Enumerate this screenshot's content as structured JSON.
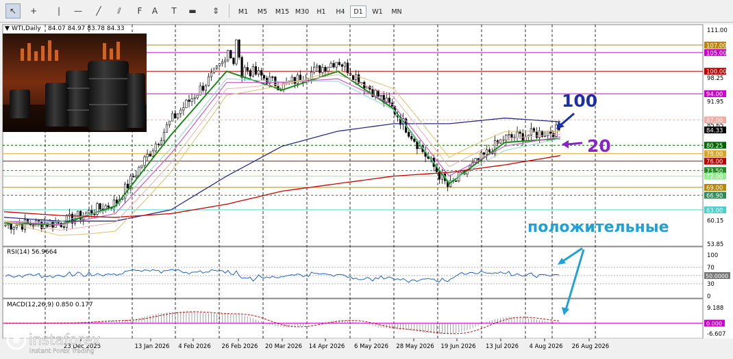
{
  "toolbar": {
    "tools": [
      {
        "name": "cursor",
        "glyph": "↖"
      },
      {
        "name": "crosshair",
        "glyph": "+"
      },
      {
        "name": "vertical-line",
        "glyph": "|"
      },
      {
        "name": "horizontal-line",
        "glyph": "—"
      },
      {
        "name": "trend-line",
        "glyph": "╱"
      },
      {
        "name": "equidistant-channel",
        "glyph": "⫽"
      },
      {
        "name": "fibonacci",
        "glyph": "F"
      },
      {
        "name": "text",
        "glyph": "A"
      },
      {
        "name": "text-label",
        "glyph": "T"
      },
      {
        "name": "rectangle",
        "glyph": "▬"
      },
      {
        "name": "arrows",
        "glyph": "⇕"
      }
    ],
    "timeframes": [
      "M1",
      "M5",
      "M15",
      "M30",
      "H1",
      "H4",
      "D1",
      "W1",
      "MN"
    ],
    "active_timeframe": "D1"
  },
  "main_panel": {
    "title": "WTI,Daily",
    "ohlc": "84.07 84.97 83.78 84.33",
    "annotation_100": "100",
    "annotation_20": "20",
    "annotation_positive": "положительные",
    "price_labels": [
      {
        "value": "111.00"
      },
      {
        "value": "98.25"
      },
      {
        "value": "91.95"
      },
      {
        "value": "85.65"
      },
      {
        "value": "60.15"
      },
      {
        "value": "53.85"
      }
    ],
    "level_tags": [
      {
        "value": "107.00",
        "color": "#b8860b"
      },
      {
        "value": "105.00",
        "color": "#cc00cc"
      },
      {
        "value": "100.00",
        "color": "#c00000"
      },
      {
        "value": "94.00",
        "color": "#cc00cc"
      },
      {
        "value": "87.00",
        "color": "#f4a9a0"
      },
      {
        "value": "84.33",
        "color": "#000000"
      },
      {
        "value": "80.25",
        "color": "#006400"
      },
      {
        "value": "78.00",
        "color": "#daa520"
      },
      {
        "value": "76.00",
        "color": "#c00000"
      },
      {
        "value": "73.50",
        "color": "#228b22"
      },
      {
        "value": "72.00",
        "color": "#90ee90"
      },
      {
        "value": "69.00",
        "color": "#b8860b"
      },
      {
        "value": "66.90",
        "color": "#2e8b57"
      },
      {
        "value": "63.00",
        "color": "#48d1cc"
      }
    ]
  },
  "rsi_panel": {
    "title": "RSI(14) 56.9664",
    "labels": [
      {
        "value": "100"
      },
      {
        "value": "70"
      },
      {
        "value": "30"
      },
      {
        "value": "0"
      }
    ],
    "tag": "50.0000"
  },
  "macd_panel": {
    "title": "MACD(12,26,9) 0.850 0.177",
    "labels": [
      {
        "value": "9.188"
      },
      {
        "value": "-6.607"
      }
    ],
    "tag": "0.000"
  },
  "x_axis": {
    "dates": [
      "23 Dec 2025",
      "13 Jan 2026",
      "4 Feb 2026",
      "26 Feb 2026",
      "20 Mar 2026",
      "14 Apr 2026",
      "6 May 2026",
      "28 May 2026",
      "19 Jun 2026",
      "13 Jul 2026",
      "4 Aug 2026",
      "26 Aug 2026"
    ]
  },
  "watermark": {
    "brand": "instaforex",
    "tagline": "Instant Forex Trading"
  },
  "chart_data": {
    "type": "line",
    "symbol": "WTI,Daily",
    "price_axis": [
      53.85,
      113.0
    ],
    "key_levels": [
      107.0,
      105.0,
      100.0,
      94.0,
      87.0,
      80.25,
      78.0,
      76.0,
      73.5,
      72.0,
      69.0,
      66.9,
      63.0
    ],
    "last_price": 84.33,
    "x": [
      "23 Dec 2025",
      "13 Jan 2026",
      "4 Feb 2026",
      "26 Feb 2026",
      "20 Mar 2026",
      "14 Apr 2026",
      "6 May 2026",
      "28 May 2026",
      "19 Jun 2026",
      "13 Jul 2026",
      "4 Aug 2026",
      "26 Aug 2026"
    ],
    "series": [
      {
        "color": "#1a1a1a",
        "values": [
          59.0,
          59.5,
          65.0,
          87.0,
          103.0,
          96.0,
          103.0,
          90.0,
          69.0,
          82.0,
          84.33,
          null
        ]
      },
      {
        "color": "#1a8a1a",
        "values": [
          59.5,
          59.0,
          64.0,
          83.0,
          100.0,
          95.0,
          100.0,
          90.0,
          70.0,
          81.0,
          82.0,
          null
        ]
      },
      {
        "color": "#cc66cc",
        "values": [
          60.0,
          59.0,
          62.0,
          78.0,
          97.0,
          97.0,
          98.0,
          91.0,
          72.0,
          80.0,
          82.5,
          null
        ]
      },
      {
        "color": "#2a2a8a",
        "values": [
          61.0,
          60.0,
          60.0,
          63.0,
          72.0,
          80.0,
          84.0,
          86.0,
          86.0,
          87.5,
          86.5,
          null
        ]
      },
      {
        "color": "#cc0000",
        "values": [
          62.5,
          61.5,
          61.0,
          62.0,
          64.5,
          68.0,
          70.0,
          72.0,
          73.0,
          75.0,
          77.5,
          null
        ]
      }
    ],
    "rsi": {
      "period": 14,
      "last": 56.9664,
      "range": [
        0,
        100
      ],
      "levels": [
        70,
        50,
        30
      ]
    },
    "macd": {
      "params": [
        12,
        26,
        9
      ],
      "macd": 0.85,
      "signal": 0.177,
      "range": [
        -6.607,
        9.188
      ]
    }
  }
}
